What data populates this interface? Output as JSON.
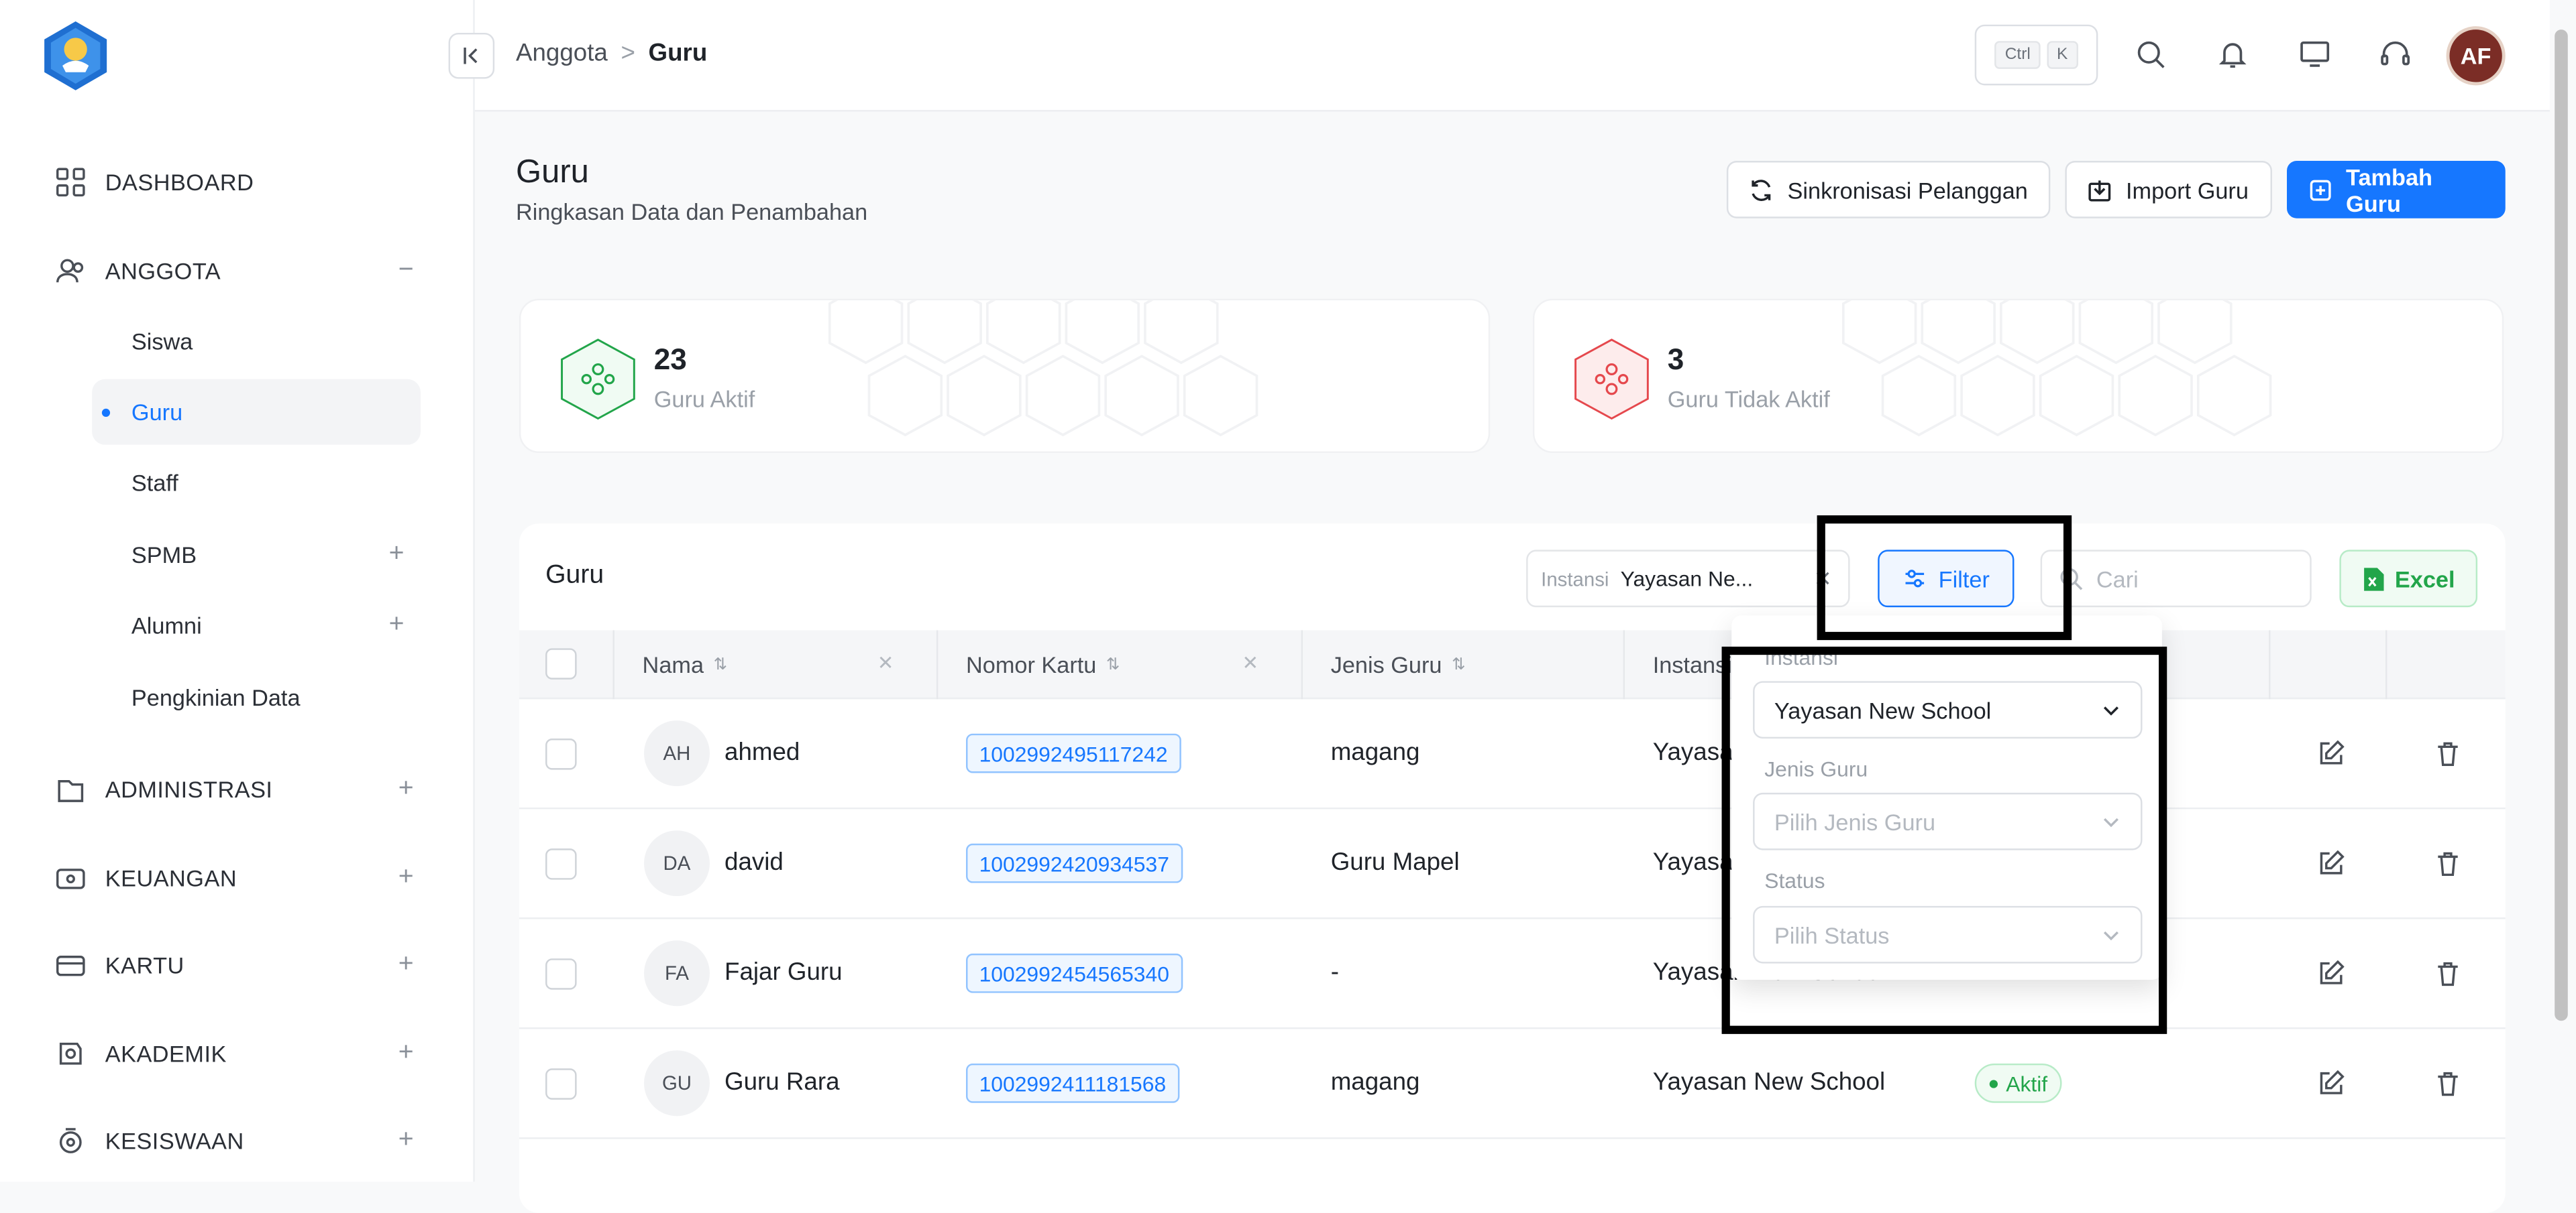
{
  "breadcrumb": {
    "parent": "Anggota",
    "sep": ">",
    "current": "Guru"
  },
  "shortcut": {
    "key1": "Ctrl",
    "key2": "K"
  },
  "user": {
    "initials": "AF"
  },
  "sidebar": {
    "dashboard": "DASHBOARD",
    "anggota": "ANGGOTA",
    "anggota_toggle": "−",
    "sub": [
      {
        "label": "Siswa"
      },
      {
        "label": "Guru"
      },
      {
        "label": "Staff"
      },
      {
        "label": "SPMB"
      },
      {
        "label": "Alumni"
      },
      {
        "label": "Pengkinian Data"
      }
    ],
    "administrasi": "ADMINISTRASI",
    "keuangan": "KEUANGAN",
    "kartu": "KARTU",
    "akademik": "AKADEMIK",
    "kesiswaan": "KESISWAAN",
    "plus": "+"
  },
  "page": {
    "title": "Guru",
    "subtitle": "Ringkasan Data dan Penambahan",
    "btn_sync": "Sinkronisasi Pelanggan",
    "btn_import": "Import Guru",
    "btn_add": "Tambah Guru"
  },
  "stats": [
    {
      "value": "23",
      "label": "Guru Aktif",
      "color": "#22a54a"
    },
    {
      "value": "3",
      "label": "Guru Tidak Aktif",
      "color": "#e5484d"
    }
  ],
  "table": {
    "title": "Guru",
    "instansi_label": "Instansi",
    "instansi_value": "Yayasan Ne...",
    "filter_label": "Filter",
    "search_placeholder": "Cari",
    "excel_label": "Excel",
    "columns": {
      "nama": "Nama",
      "nomor": "Nomor Kartu",
      "jenis": "Jenis Guru",
      "instansi": "Instansi"
    },
    "rows": [
      {
        "initials": "AH",
        "name": "ahmed",
        "card": "1002992495117242",
        "jenis": "magang",
        "instansi": "Yayasan New School",
        "status": ""
      },
      {
        "initials": "DA",
        "name": "david",
        "card": "1002992420934537",
        "jenis": "Guru Mapel",
        "instansi": "Yayasan New School",
        "status": ""
      },
      {
        "initials": "FA",
        "name": "Fajar Guru",
        "card": "1002992454565340",
        "jenis": "-",
        "instansi": "Yayasan New School",
        "status": ""
      },
      {
        "initials": "GU",
        "name": "Guru Rara",
        "card": "1002992411181568",
        "jenis": "magang",
        "instansi": "Yayasan New School",
        "status": "Aktif"
      }
    ]
  },
  "filter_panel": {
    "instansi_label": "Instansi",
    "instansi_value": "Yayasan New School",
    "jenis_label": "Jenis Guru",
    "jenis_placeholder": "Pilih Jenis Guru",
    "status_label": "Status",
    "status_placeholder": "Pilih Status"
  },
  "colors": {
    "accent": "#1677ff",
    "success": "#22a54a",
    "danger": "#e5484d"
  }
}
